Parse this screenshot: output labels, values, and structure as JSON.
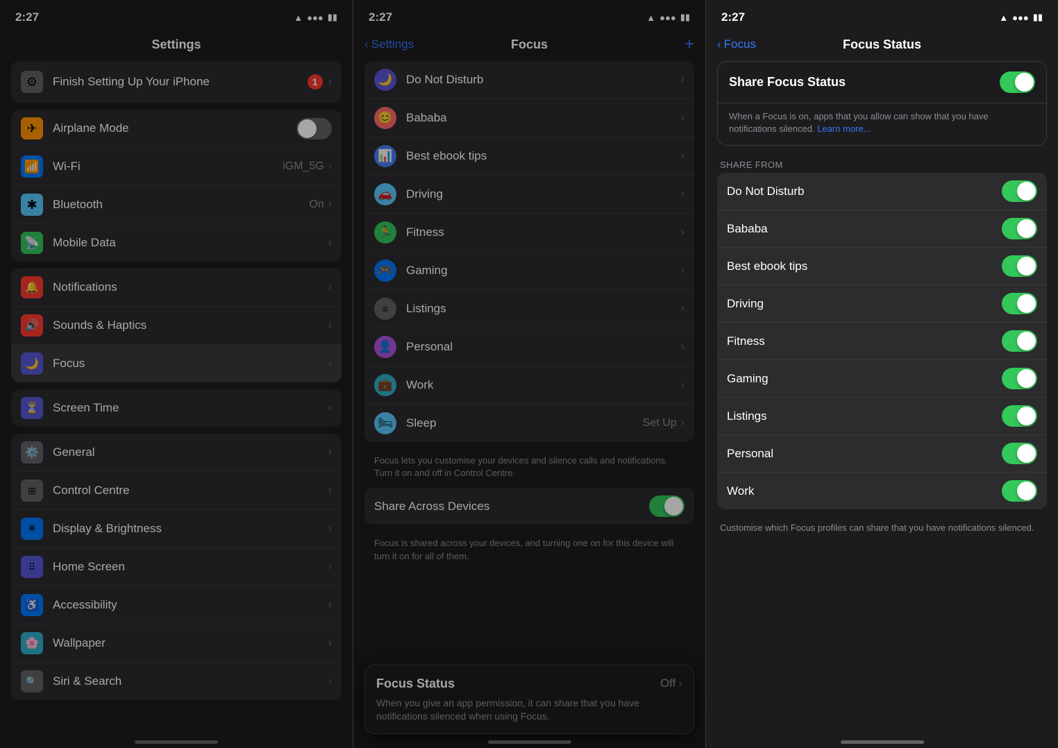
{
  "colors": {
    "accent": "#3478f6",
    "green": "#34c759",
    "red": "#ff3b30",
    "gray": "#8e8e93"
  },
  "panel1": {
    "statusTime": "2:27",
    "title": "Settings",
    "finishBanner": {
      "text": "Finish Setting Up Your iPhone",
      "badge": "1"
    },
    "groups": [
      {
        "items": [
          {
            "id": "airplane",
            "label": "Airplane Mode",
            "iconBg": "bg-orange",
            "iconChar": "✈",
            "hasToggle": true,
            "toggleOn": false
          },
          {
            "id": "wifi",
            "label": "Wi-Fi",
            "iconBg": "bg-blue",
            "iconChar": "📶",
            "value": "iGM_5G",
            "hasChevron": true
          },
          {
            "id": "bluetooth",
            "label": "Bluetooth",
            "iconBg": "bg-blue2",
            "iconChar": "⚡",
            "value": "On",
            "hasChevron": true
          },
          {
            "id": "mobiledata",
            "label": "Mobile Data",
            "iconBg": "bg-green",
            "iconChar": "📡",
            "hasChevron": true
          }
        ]
      },
      {
        "items": [
          {
            "id": "notifications",
            "label": "Notifications",
            "iconBg": "bg-red",
            "iconChar": "🔔",
            "hasChevron": true
          },
          {
            "id": "sounds",
            "label": "Sounds & Haptics",
            "iconBg": "bg-red",
            "iconChar": "🔊",
            "hasChevron": true
          },
          {
            "id": "focus",
            "label": "Focus",
            "iconBg": "bg-moon",
            "iconChar": "🌙",
            "hasChevron": true,
            "active": true
          }
        ]
      },
      {
        "items": [
          {
            "id": "screentime",
            "label": "Screen Time",
            "iconBg": "bg-indigo",
            "iconChar": "⏳",
            "hasChevron": true
          }
        ]
      },
      {
        "items": [
          {
            "id": "general",
            "label": "General",
            "iconBg": "bg-gray",
            "iconChar": "⚙️",
            "hasChevron": true
          },
          {
            "id": "controlcentre",
            "label": "Control Centre",
            "iconBg": "bg-gray",
            "iconChar": "⊞",
            "hasChevron": true
          },
          {
            "id": "displaybrightness",
            "label": "Display & Brightness",
            "iconBg": "bg-blue",
            "iconChar": "☀",
            "hasChevron": true
          },
          {
            "id": "homescreen",
            "label": "Home Screen",
            "iconBg": "bg-indigo",
            "iconChar": "⠿",
            "hasChevron": true
          },
          {
            "id": "accessibility",
            "label": "Accessibility",
            "iconBg": "bg-blue",
            "iconChar": "♿",
            "hasChevron": true
          },
          {
            "id": "wallpaper",
            "label": "Wallpaper",
            "iconBg": "bg-teal",
            "iconChar": "🌸",
            "hasChevron": true
          },
          {
            "id": "siri",
            "label": "Siri & Search",
            "iconBg": "bg-gray",
            "iconChar": "🔍",
            "hasChevron": true
          }
        ]
      }
    ]
  },
  "panel2": {
    "statusTime": "2:27",
    "backLabel": "Settings",
    "title": "Focus",
    "addLabel": "+",
    "focusItems": [
      {
        "id": "donotdisturb",
        "label": "Do Not Disturb",
        "iconBg": "#5856d6",
        "iconChar": "🌙"
      },
      {
        "id": "bababa",
        "label": "Bababa",
        "iconBg": "#ff6b6b",
        "iconChar": "😊"
      },
      {
        "id": "bestebooktips",
        "label": "Best ebook tips",
        "iconBg": "#4a7cf7",
        "iconChar": "📊"
      },
      {
        "id": "driving",
        "label": "Driving",
        "iconBg": "#5ac8fa",
        "iconChar": "🚗"
      },
      {
        "id": "fitness",
        "label": "Fitness",
        "iconBg": "#34c759",
        "iconChar": "🏃"
      },
      {
        "id": "gaming",
        "label": "Gaming",
        "iconBg": "#007aff",
        "iconChar": "🎮"
      },
      {
        "id": "listings",
        "label": "Listings",
        "iconBg": "#636366",
        "iconChar": "≡"
      },
      {
        "id": "personal",
        "label": "Personal",
        "iconBg": "#af52de",
        "iconChar": "👤"
      },
      {
        "id": "work",
        "label": "Work",
        "iconBg": "#30b0c7",
        "iconChar": "💼"
      },
      {
        "id": "sleep",
        "label": "Sleep",
        "iconBg": "#5ac8fa",
        "iconChar": "🛏"
      }
    ],
    "sleepValue": "Set Up",
    "shareAcrossDevices": {
      "label": "Share Across Devices",
      "toggleOn": true
    },
    "shareAcrossFooter": "Focus is shared across your devices, and turning one on for this device will turn it on for all of them.",
    "footerText": "Focus lets you customise your devices and silence calls and notifications. Turn it on and off in Control Centre.",
    "popupCard": {
      "title": "Focus Status",
      "value": "Off",
      "body": "When you give an app permission, it can share that you have notifications silenced when using Focus."
    }
  },
  "panel3": {
    "statusTime": "2:27",
    "backLabel": "Focus",
    "title": "Focus Status",
    "shareCard": {
      "toggleLabel": "Share Focus Status",
      "toggleOn": true,
      "desc": "When a Focus is on, apps that you allow can show that you have notifications silenced.",
      "learnMore": "Learn more..."
    },
    "shareFromLabel": "SHARE FROM",
    "shareFromItems": [
      {
        "id": "donotdisturb",
        "label": "Do Not Disturb",
        "toggleOn": true
      },
      {
        "id": "bababa",
        "label": "Bababa",
        "toggleOn": true
      },
      {
        "id": "bestebooktips",
        "label": "Best ebook tips",
        "toggleOn": true
      },
      {
        "id": "driving",
        "label": "Driving",
        "toggleOn": true
      },
      {
        "id": "fitness",
        "label": "Fitness",
        "toggleOn": true
      },
      {
        "id": "gaming",
        "label": "Gaming",
        "toggleOn": true
      },
      {
        "id": "listings",
        "label": "Listings",
        "toggleOn": true
      },
      {
        "id": "personal",
        "label": "Personal",
        "toggleOn": true
      },
      {
        "id": "work",
        "label": "Work",
        "toggleOn": true
      }
    ],
    "customizeFooter": "Customise which Focus profiles can share that you have notifications silenced."
  }
}
